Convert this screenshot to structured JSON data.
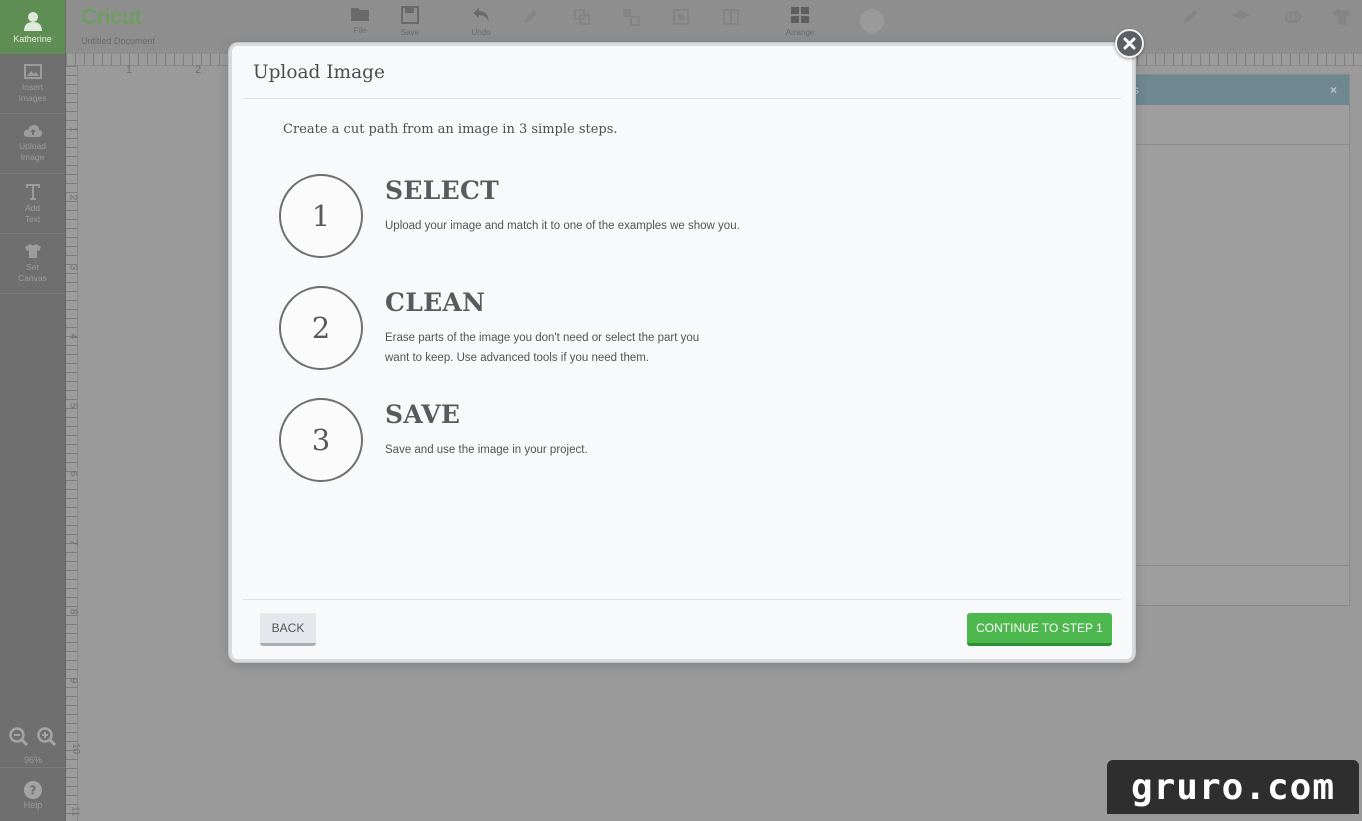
{
  "app": {
    "user_name": "Katherine",
    "logo_text": "Cricut",
    "document_name": "Untitled Document",
    "sidebar": {
      "items": [
        {
          "label": "Insert\nImages",
          "icon": "image-icon"
        },
        {
          "label": "Upload\nImage",
          "icon": "cloud-upload-icon"
        },
        {
          "label": "Add\nText",
          "icon": "text-icon"
        },
        {
          "label": "Set\nCanvas",
          "icon": "shirt-icon"
        }
      ],
      "zoom_label": "96%",
      "help_label": "Help"
    },
    "toolbar": {
      "file_label": "File",
      "save_label": "Save",
      "undo_label": "Undo",
      "arrange_label": "Arrange"
    },
    "ruler": {
      "top": [
        "1",
        "2"
      ],
      "left": [
        "1",
        "2",
        "3",
        "4",
        "5",
        "6",
        "7",
        "8",
        "9",
        "10",
        "11"
      ]
    },
    "layers_panel": {
      "title_fragment": "rs",
      "close_symbol": "×"
    }
  },
  "modal": {
    "title": "Upload Image",
    "intro": "Create a cut path from an image in 3 simple steps.",
    "steps": [
      {
        "number": "1",
        "title": "SELECT",
        "description": "Upload your image and match it to one of the examples we show you."
      },
      {
        "number": "2",
        "title": "CLEAN",
        "description": "Erase parts of the image you don't need or select the part you want to keep. Use advanced tools if you need them."
      },
      {
        "number": "3",
        "title": "SAVE",
        "description": "Save and use the image in your project."
      }
    ],
    "back_label": "BACK",
    "continue_label": "CONTINUE TO STEP 1"
  },
  "watermark": "gruro.com",
  "colors": {
    "continue_green": "#4cb84d",
    "overlay_gray": "#9a9a9a",
    "modal_bg": "#f8f9fa",
    "sidebar_user_green": "#5f8e54"
  }
}
